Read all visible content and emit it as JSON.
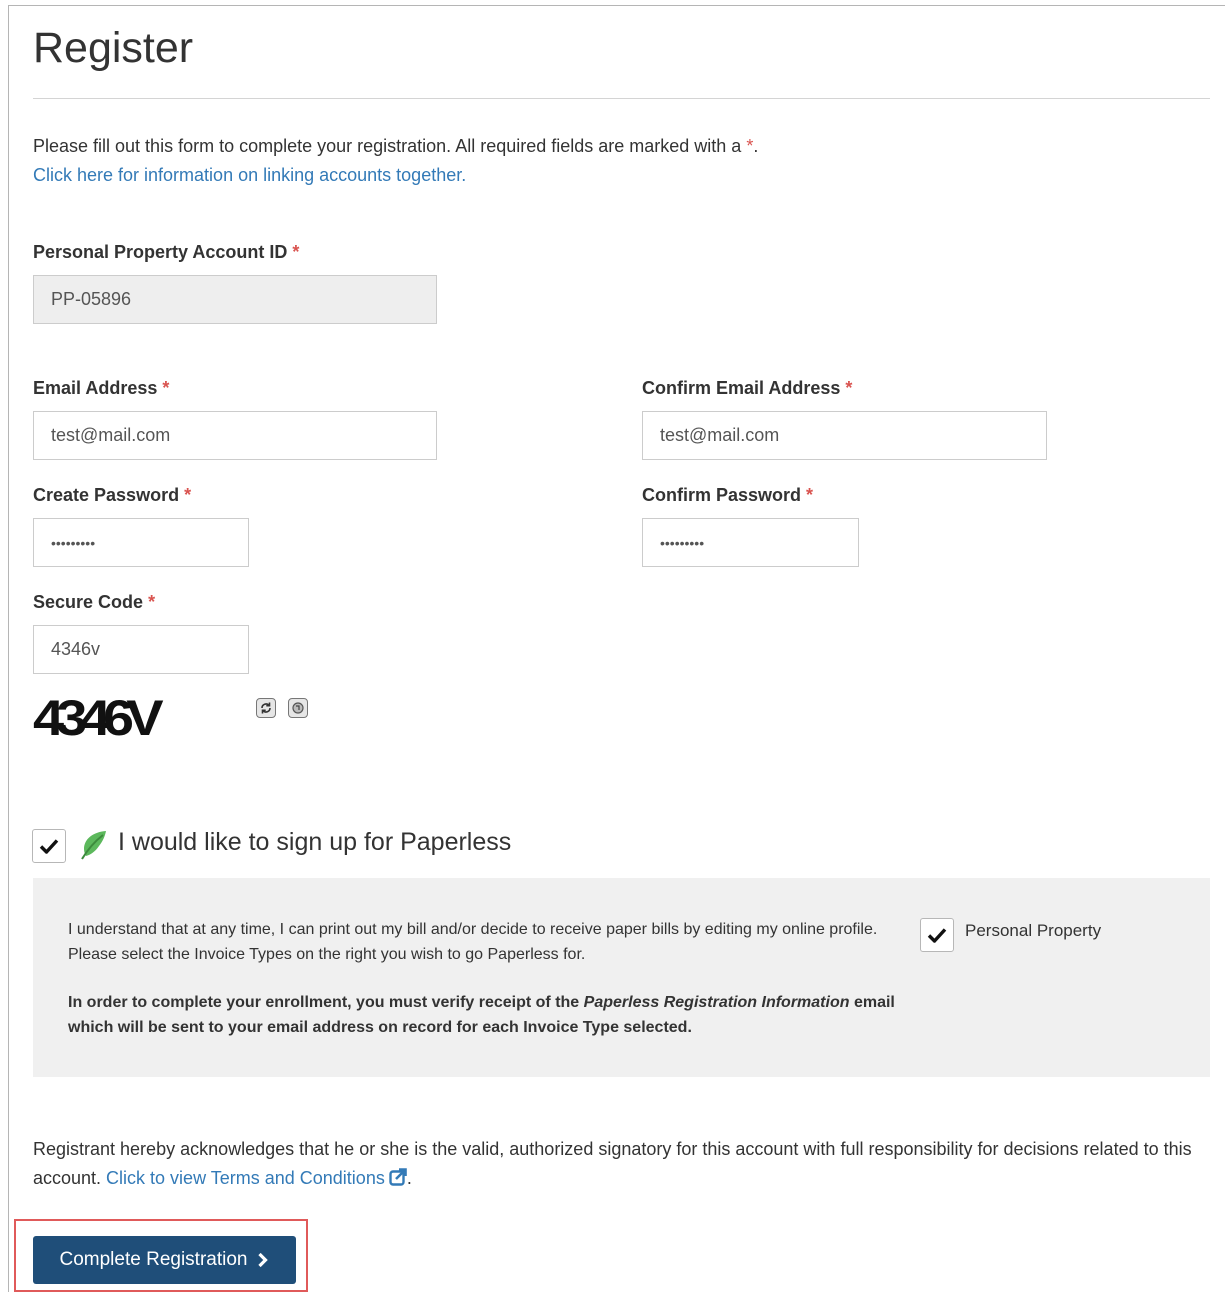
{
  "page": {
    "title": "Register",
    "intro_text": "Please fill out this form to complete your registration. All required fields are marked with a ",
    "required_marker": "*",
    "intro_end": ".",
    "linking_link": "Click here for information on linking accounts together."
  },
  "form": {
    "account_id": {
      "label": "Personal Property Account ID",
      "value": "PP-05896"
    },
    "email": {
      "label": "Email Address",
      "value": "test@mail.com"
    },
    "confirm_email": {
      "label": "Confirm Email Address",
      "value": "test@mail.com"
    },
    "password": {
      "label": "Create Password",
      "value": "•••••••••"
    },
    "confirm_password": {
      "label": "Confirm Password",
      "value": "•••••••••"
    },
    "secure_code": {
      "label": "Secure Code",
      "value": "4346v"
    },
    "captcha_text": "4346V",
    "captcha_icons": [
      "refresh-icon",
      "audio-icon"
    ]
  },
  "paperless": {
    "checked": true,
    "label": "I would like to sign up for Paperless",
    "icon": "leaf-icon",
    "info_text": "I understand that at any time, I can print out my bill and/or decide to receive paper bills by editing my online profile. Please select the Invoice Types on the right you wish to go Paperless for.",
    "notice_part1": "In order to complete your enrollment, you must verify receipt of the ",
    "notice_emphasis": "Paperless Registration Information",
    "notice_part2": " email which will be sent to your email address on record for each Invoice Type selected.",
    "invoice_types": [
      {
        "label": "Personal Property",
        "checked": true
      }
    ]
  },
  "acknowledgement": {
    "text": "Registrant hereby acknowledges that he or she is the valid, authorized signatory for this account with full responsibility for decisions related to this account. ",
    "terms_link": "Click to view Terms and Conditions",
    "end": "."
  },
  "submit": {
    "label": "Complete Registration",
    "icon": "chevron-right-icon"
  },
  "colors": {
    "required": "#d9534f",
    "link": "#337ab7",
    "button_bg": "#1f4e79",
    "panel_bg": "#f0f0f0",
    "highlight_outline": "#e05a5a",
    "leaf": "#5cb85c"
  }
}
